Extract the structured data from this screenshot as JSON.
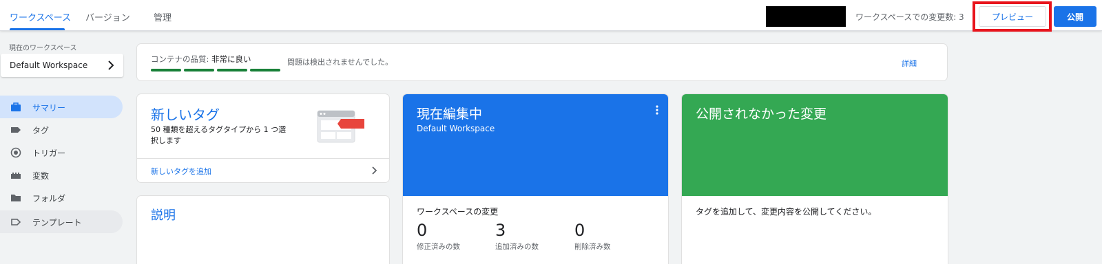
{
  "header": {
    "tabs": [
      {
        "label": "ワークスペース"
      },
      {
        "label": "バージョン"
      },
      {
        "label": "管理"
      }
    ],
    "change_count_text": "ワークスペースでの変更数: 3",
    "preview_label": "プレビュー",
    "publish_label": "公開"
  },
  "sidebar": {
    "workspace_label": "現在のワークスペース",
    "workspace_name": "Default Workspace",
    "items": [
      {
        "label": "サマリー",
        "icon": "briefcase-icon"
      },
      {
        "label": "タグ",
        "icon": "tag-icon"
      },
      {
        "label": "トリガー",
        "icon": "trigger-icon"
      },
      {
        "label": "変数",
        "icon": "variable-icon"
      },
      {
        "label": "フォルダ",
        "icon": "folder-icon"
      },
      {
        "label": "テンプレート",
        "icon": "template-icon"
      }
    ]
  },
  "quality": {
    "label": "コンテナの品質: ",
    "value": "非常に良い",
    "message": "問題は検出されませんでした。",
    "details_label": "詳細"
  },
  "new_tag": {
    "title": "新しいタグ",
    "description": "50 種類を超えるタグタイプから 1 つ選択します",
    "link": "新しいタグを追加"
  },
  "description": {
    "title": "説明"
  },
  "editing": {
    "title": "現在編集中",
    "workspace": "Default Workspace",
    "changes_label": "ワークスペースの変更",
    "stats": [
      {
        "value": "0",
        "label": "修正済みの数"
      },
      {
        "value": "3",
        "label": "追加済みの数"
      },
      {
        "value": "0",
        "label": "削除済み数"
      }
    ]
  },
  "unpublished": {
    "title": "公開されなかった変更",
    "message": "タグを追加して、変更内容を公開してください。"
  },
  "colors": {
    "accent": "#1a73e8",
    "success": "#34a853",
    "quality_bar": "#188038",
    "highlight": "#e8141c"
  }
}
